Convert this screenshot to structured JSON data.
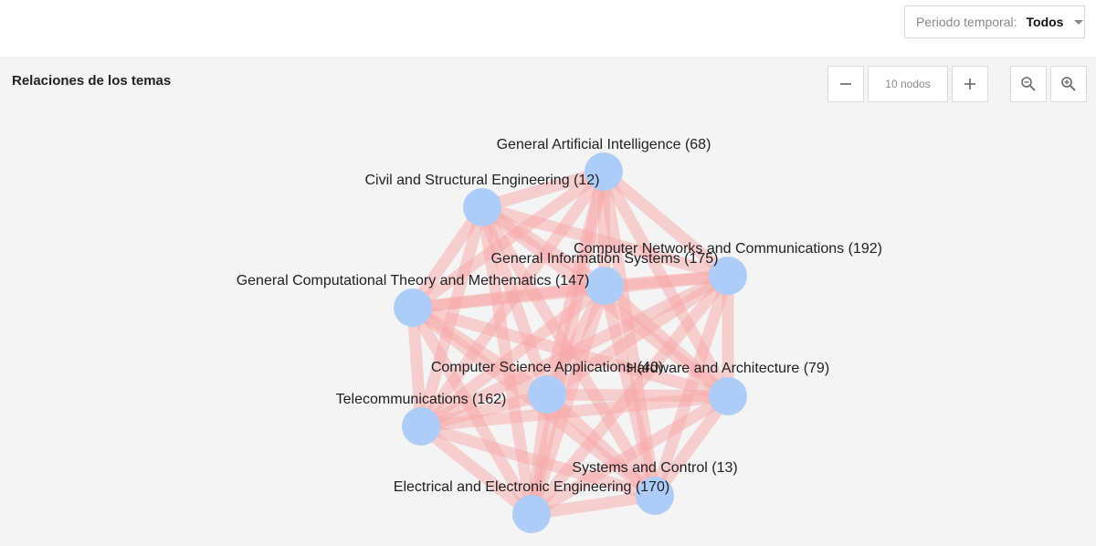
{
  "filter": {
    "label": "Periodo temporal:",
    "value": "Todos"
  },
  "panel": {
    "title": "Relaciones de los temas",
    "nodes_count": "10 nodos"
  },
  "icons": {
    "minus": "minus-icon",
    "plus": "plus-icon",
    "zoom_out": "zoom-out-icon",
    "zoom_in": "zoom-in-icon",
    "dropdown": "caret-down-icon"
  },
  "colors": {
    "node": "#aeccf8",
    "edge": "#f7a8a8",
    "panel_background": "#f4f4f4"
  },
  "graph": {
    "nodes": [
      {
        "id": "gai",
        "label": "General Artificial Intelligence (68)"
      },
      {
        "id": "cse",
        "label": "Civil and Structural Engineering (12)"
      },
      {
        "id": "cnc",
        "label": "Computer Networks and Communications (192)"
      },
      {
        "id": "gis",
        "label": "General Information Systems (175)"
      },
      {
        "id": "gct",
        "label": "General Computational Theory and Methematics (147)"
      },
      {
        "id": "csa",
        "label": "Computer Science Applications (40)"
      },
      {
        "id": "haa",
        "label": "Hardware and Architecture (79)"
      },
      {
        "id": "tel",
        "label": "Telecommunications (162)"
      },
      {
        "id": "sac",
        "label": "Systems and Control (13)"
      },
      {
        "id": "eee",
        "label": "Electrical and Electronic Engineering (170)"
      }
    ]
  }
}
